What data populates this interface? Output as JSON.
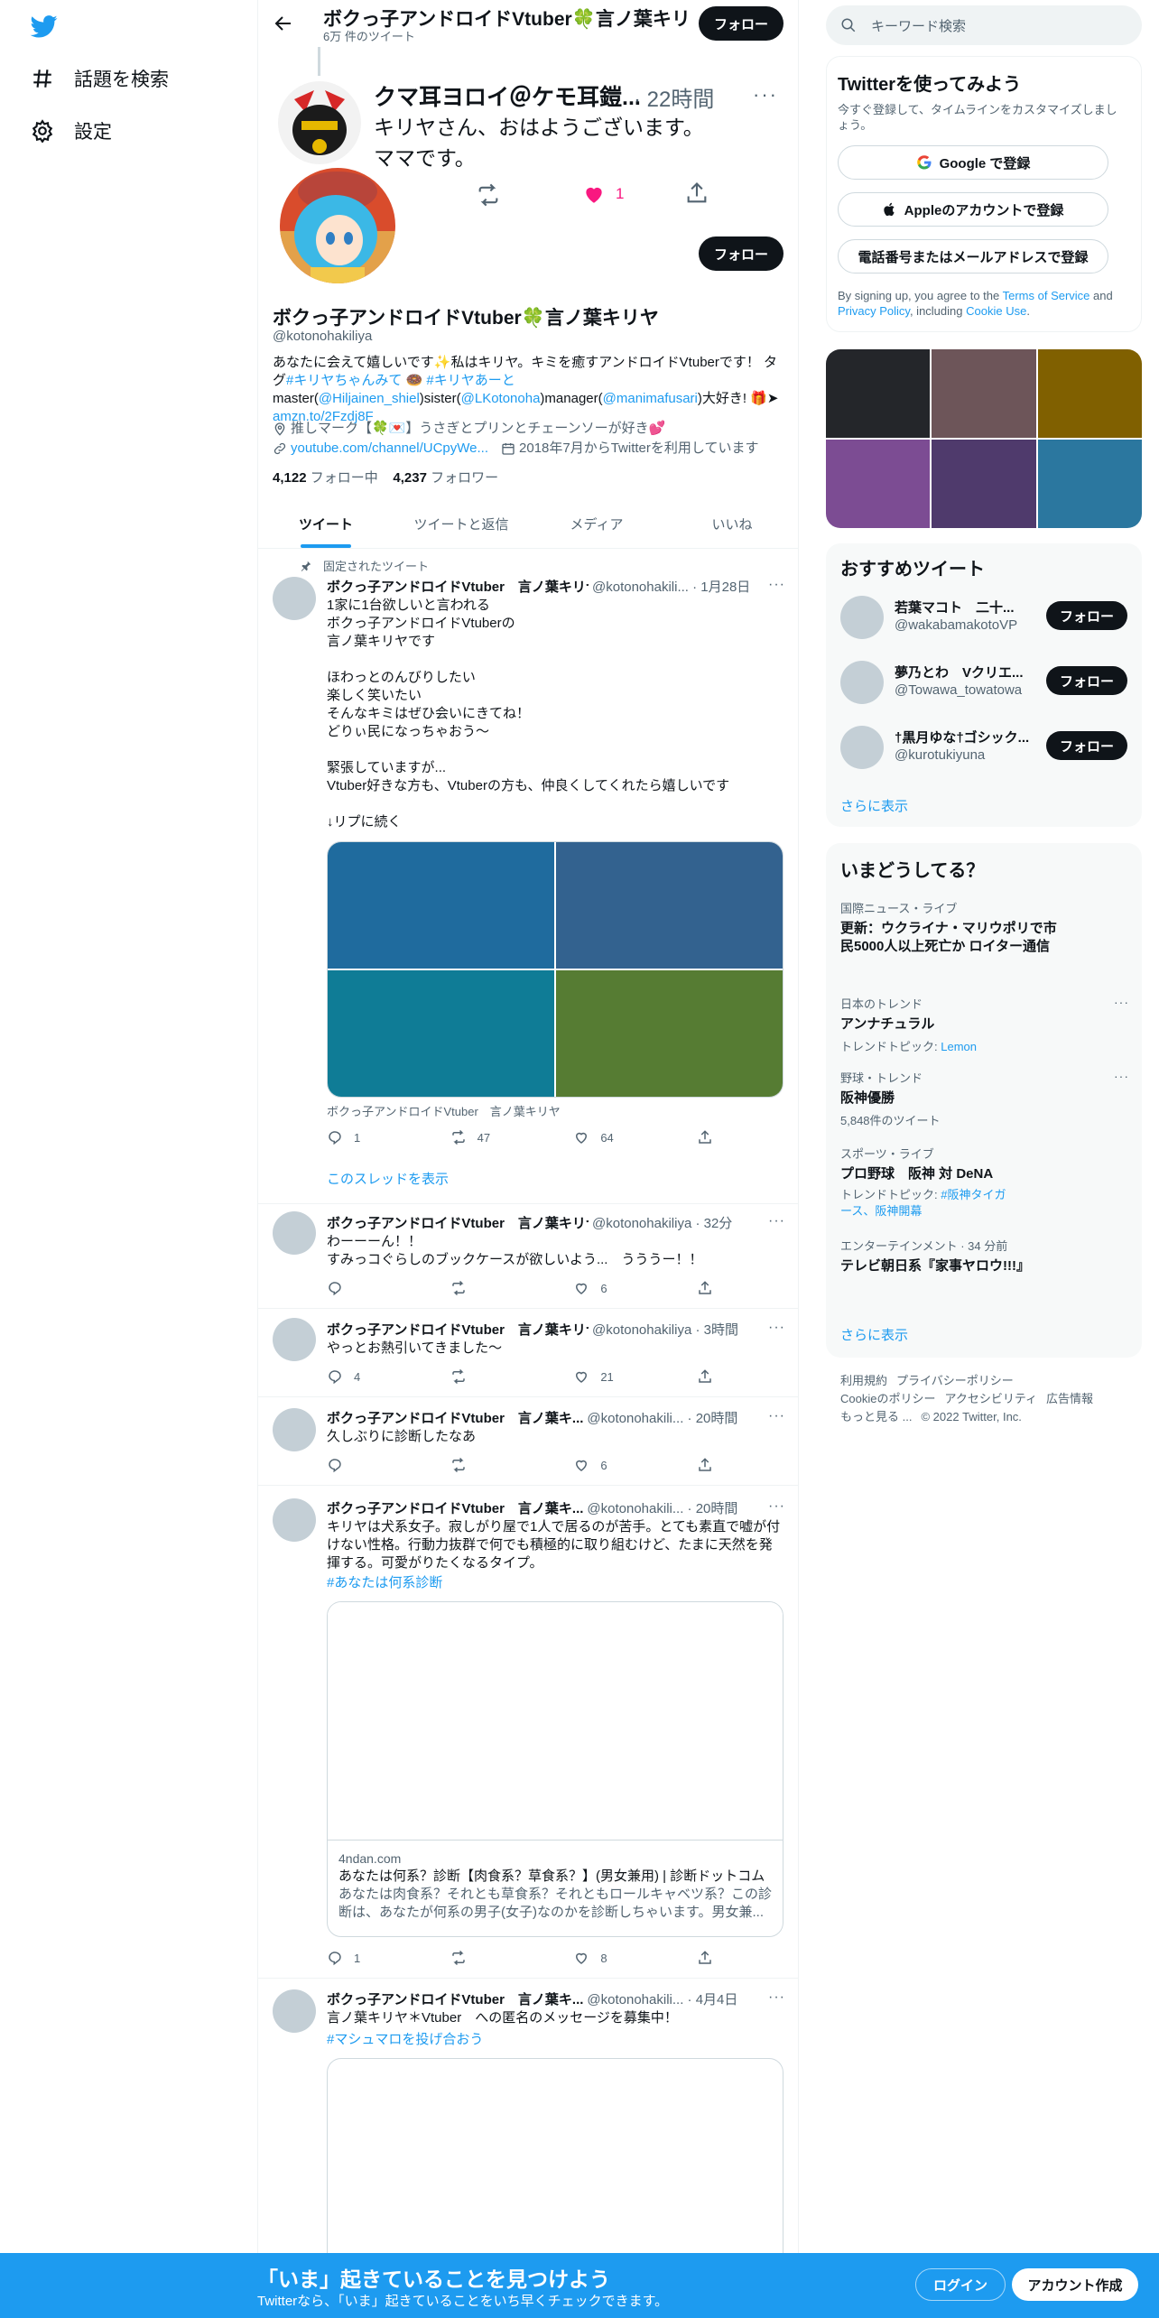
{
  "nav": {
    "explore_label": "話題を検索",
    "settings_label": "設定"
  },
  "header": {
    "name": "ボクっ子アンドロイドVtuber🍀言ノ葉キリヤ",
    "tweet_count": "6万 件のツイート",
    "follow_label": "フォロー"
  },
  "overlay_tweet": {
    "name": "クマ耳ヨロイ＠ケモ耳鎧...",
    "time": "· 22時間",
    "dots": "···",
    "text": "キリヤさん、おはようございます。\nママです。",
    "like_count": "1"
  },
  "profile": {
    "follow_label": "フォロー",
    "name": "ボクっ子アンドロイドVtuber🍀言ノ葉キリヤ",
    "handle": "@kotonohakiliya",
    "bio_1": "あなたに会えて嬉しいです✨私はキリヤ。キミを癒すアンドロイドVtuberです！ タグ",
    "bio_tag1": "#キリヤちゃんみて",
    "bio_emoji": " 🍩 ",
    "bio_tag2": "#キリヤあーと",
    "bio_2": " master(",
    "bio_m1": "@Hiljainen_shiel",
    "bio_3": ")sister(",
    "bio_m2": "@LKotonoha",
    "bio_4": ")manager(",
    "bio_m3": "@manimafusari",
    "bio_5": ")大好き! 🎁➤ ",
    "bio_link": "amzn.to/2Fzdj8F",
    "location": "推しマーク【🍀💌】うさぎとプリンとチェーンソーが好き💕",
    "website": "youtube.com/channel/UCpyWe...",
    "joined": "2018年7月からTwitterを利用しています",
    "following_count": "4,122",
    "following_label": "フォロー中",
    "followers_count": "4,237",
    "followers_label": "フォロワー"
  },
  "tabs": [
    "ツイート",
    "ツイートと返信",
    "メディア",
    "いいね"
  ],
  "pinned_label": "固定されたツイート",
  "tweets": [
    {
      "name": "ボクっ子アンドロイドVtuber　言ノ葉キリヤ",
      "meta": "@kotonohakili... · 1月28日",
      "text": "1家に1台欲しいと言われる\nボクっ子アンドロイドVtuberの\n言ノ葉キリヤです\n\nほわっとのんびりしたい\n楽しく笑いたい\nそんなキミはぜひ会いにきてね！\nどりぃ民になっちゃおう～\n\n緊張していますが...\nVtuber好きな方も、Vtuberの方も、仲良くしてくれたら嬉しいです\n\n↓リプに続く",
      "media_caption": "ボクっ子アンドロイドVtuber　言ノ葉キリヤ",
      "reply": "1",
      "retweet": "47",
      "like": "64",
      "thread_label": "このスレッドを表示"
    },
    {
      "name": "ボクっ子アンドロイドVtuber　言ノ葉キリヤ",
      "meta": "@kotonohakiliya · 32分",
      "text": "わーーーん！！\nすみっコぐらしのブックケースが欲しいよう...　うううー！！",
      "reply": "",
      "retweet": "",
      "like": "6"
    },
    {
      "name": "ボクっ子アンドロイドVtuber　言ノ葉キリヤ",
      "meta": "@kotonohakiliya · 3時間",
      "text": "やっとお熱引いてきました～",
      "reply": "4",
      "retweet": "",
      "like": "21"
    },
    {
      "name": "ボクっ子アンドロイドVtuber　言ノ葉キ...",
      "meta": "@kotonohakili... · 20時間",
      "text": "久しぶりに診断したなあ",
      "reply": "",
      "retweet": "",
      "like": "6"
    },
    {
      "name": "ボクっ子アンドロイドVtuber　言ノ葉キ...",
      "meta": "@kotonohakili... · 20時間",
      "text": "キリヤは犬系女子。寂しがり屋で1人で居るのが苦手。とても素直で嘘が付けない性格。行動力抜群で何でも積極的に取り組むけど、たまに天然を発揮する。可愛がりたくなるタイプ。",
      "hashtag": "#あなたは何系診断",
      "card_domain": "4ndan.com",
      "card_title": "あなたは何系？診断【肉食系？草食系？】(男女兼用) | 診断ドットコム",
      "card_desc": "あなたは肉食系？それとも草食系？それともロールキャベツ系？この診断は、あなたが何系の男子(女子)なのかを診断しちゃいます。男女兼...",
      "reply": "1",
      "retweet": "",
      "like": "8"
    },
    {
      "name": "ボクっ子アンドロイドVtuber　言ノ葉キ...",
      "meta": "@kotonohakili... · 4月4日",
      "text": "言ノ葉キリヤ＊Vtuber　への匿名のメッセージを募集中！",
      "hashtag": "#マシュマロを投げ合おう"
    }
  ],
  "right": {
    "search_placeholder": "キーワード検索",
    "signup_title": "Twitterを使ってみよう",
    "signup_sub": "今すぐ登録して、タイムラインをカスタマイズしましょう。",
    "google_btn": "Google で登録",
    "apple_btn": "Appleのアカウントで登録",
    "phone_btn": "電話番号またはメールアドレスで登録",
    "terms_1": "By signing up, you agree to the ",
    "terms_link1": "Terms of Service",
    "terms_2": " and ",
    "terms_link2": "Privacy Policy",
    "terms_3": ", including ",
    "terms_link3": "Cookie Use",
    "terms_4": ".",
    "rec_title": "おすすめツイート",
    "recs": [
      {
        "name": "若葉マコト　二十...",
        "handle": "@wakabamakotoVP"
      },
      {
        "name": "夢乃とわ　Vクリエ...",
        "handle": "@Towawa_towatowa"
      },
      {
        "name": "†黒月ゆな†ゴシック...",
        "handle": "@kurotukiyuna"
      }
    ],
    "follow_label": "フォロー",
    "show_more": "さらに表示",
    "trends_title": "いまどうしてる？",
    "trends": [
      {
        "cat": "国際ニュース・ライブ",
        "name": "更新：ウクライナ・マリウポリで市民5000人以上死亡か ロイター通信",
        "sub": ""
      },
      {
        "cat": "日本のトレンド",
        "name": "アンナチュラル",
        "sub_label": "トレンドトピック: ",
        "sub_link": "Lemon"
      },
      {
        "cat": "野球・トレンド",
        "name": "阪神優勝",
        "sub": "5,848件のツイート"
      },
      {
        "cat": "スポーツ・ライブ",
        "name": "プロ野球　阪神 対 DeNA",
        "sub_label": "トレンドトピック: ",
        "sub_link": "#阪神タイガース、阪神開幕"
      },
      {
        "cat": "エンターテインメント · 34 分前",
        "name": "テレビ朝日系『家事ヤロウ!!!』",
        "sub": ""
      }
    ],
    "trends_more": "さらに表示",
    "footer": [
      "利用規約",
      "プライバシーポリシー",
      "Cookieのポリシー",
      "アクセシビリティ",
      "広告情報",
      "もっと見る ...",
      "© 2022 Twitter, Inc."
    ]
  },
  "bottom": {
    "title": "「いま」起きていることを見つけよう",
    "sub": "Twitterなら、「いま」起きていることをいち早くチェックできます。",
    "login": "ログイン",
    "signup": "アカウント作成"
  },
  "colors": {
    "accent": "#1d9bf0",
    "text": "#0f1419",
    "muted": "#536471",
    "like": "#f91880",
    "media": [
      "#1f6b9e",
      "#33628f",
      "#0f7c96",
      "#567c33"
    ],
    "photos": [
      "#24262a",
      "#6d5559",
      "#806000",
      "#7c4c93",
      "#4f3a6c",
      "#2b779f"
    ]
  }
}
